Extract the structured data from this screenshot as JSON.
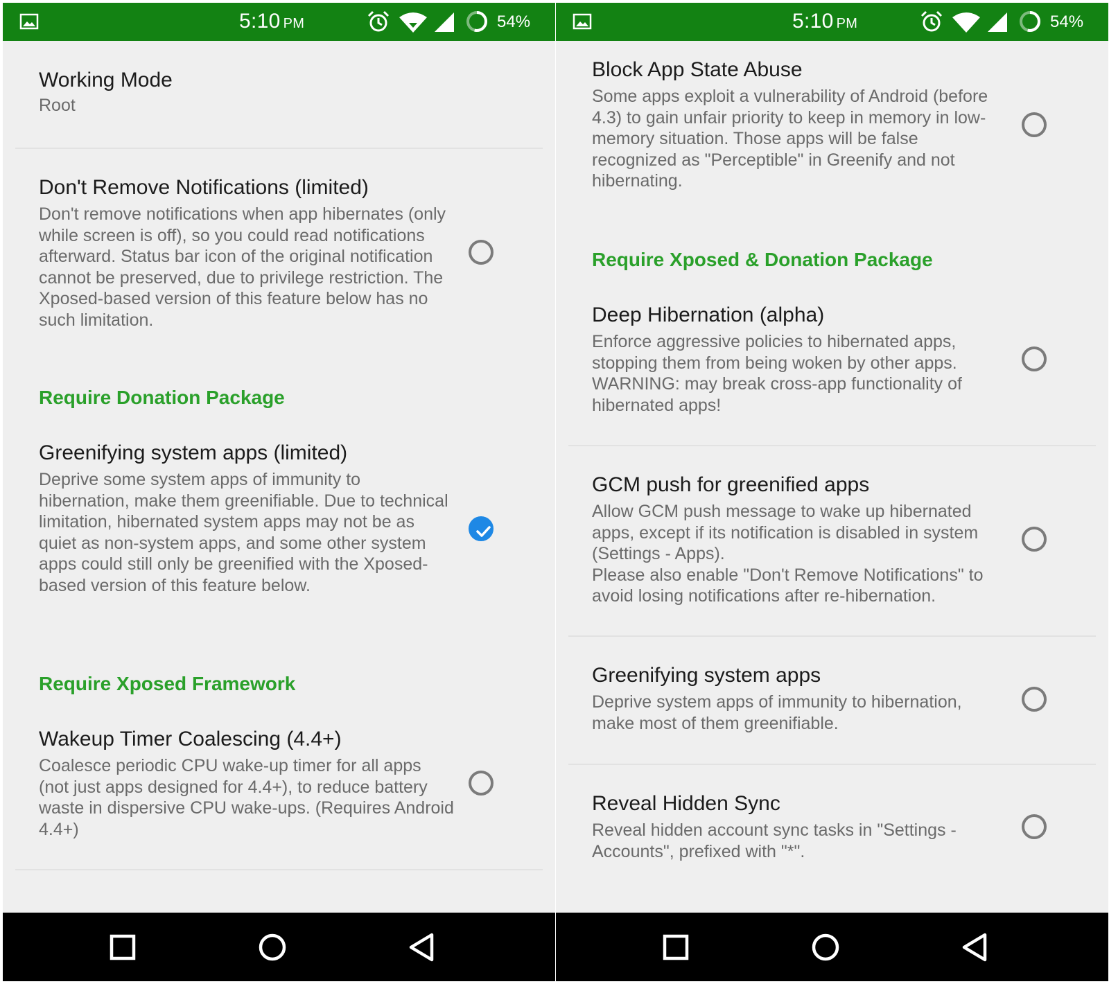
{
  "status_bar": {
    "time": "5:10",
    "ampm": "PM",
    "battery": "54%",
    "icons": [
      "image-icon",
      "alarm-icon",
      "wifi-icon",
      "signal-icon",
      "battery-icon"
    ]
  },
  "colors": {
    "status_bar": "#138213",
    "category": "#2aa02a",
    "checked": "#1e88e5",
    "background": "#efefef"
  },
  "left": {
    "working_mode": {
      "title": "Working Mode",
      "value": "Root"
    },
    "dont_remove": {
      "title": "Don't Remove Notifications (limited)",
      "summary": "Don't remove notifications when app hibernates (only while screen is off), so you could read notifications afterward. Status bar icon of the original notification cannot be preserved, due to privilege restriction. The Xposed-based version of this feature below has no such limitation.",
      "checked": false
    },
    "category_donation": "Require Donation Package",
    "greenify_system_limited": {
      "title": "Greenifying system apps (limited)",
      "summary": "Deprive some system apps of immunity to hibernation, make them greenifiable. Due to technical limitation, hibernated system apps may not be as quiet as non-system apps, and some other system apps could still only be greenified with the Xposed-based version of this feature below.",
      "checked": true
    },
    "category_xposed": "Require Xposed Framework",
    "wakeup_timer": {
      "title": "Wakeup Timer Coalescing (4.4+)",
      "summary": "Coalesce periodic CPU wake-up timer for all apps (not just apps designed for 4.4+), to reduce battery waste in dispersive CPU wake-ups. (Requires Android 4.4+)",
      "checked": false
    }
  },
  "right": {
    "block_app_state": {
      "title": "Block App State Abuse",
      "summary": "Some apps exploit a vulnerability of Android (before 4.3) to gain unfair priority to keep in memory in low-memory situation. Those apps will be false recognized as \"Perceptible\" in Greenify and not hibernating.",
      "checked": false
    },
    "category_xposed_donation": "Require Xposed & Donation Package",
    "deep_hibernation": {
      "title": "Deep Hibernation (alpha)",
      "summary": "Enforce aggressive policies to hibernated apps, stopping them from being woken by other apps. WARNING: may break cross-app functionality of hibernated apps!",
      "checked": false
    },
    "gcm_push": {
      "title": "GCM push for greenified apps",
      "summary_1": "Allow GCM push message to wake up hibernated apps, except if its notification is disabled in system (Settings - Apps).",
      "summary_2": "Please also enable \"Don't Remove Notifications\" to avoid losing notifications after re-hibernation.",
      "checked": false
    },
    "greenify_system": {
      "title": "Greenifying system apps",
      "summary": "Deprive system apps of immunity to hibernation, make most of them greenifiable.",
      "checked": false
    },
    "reveal_sync": {
      "title": "Reveal Hidden Sync",
      "summary": "Reveal hidden account sync tasks in \"Settings - Accounts\", prefixed with \"*\".",
      "checked": false
    }
  },
  "nav": {
    "icons": [
      "recents-icon",
      "home-icon",
      "back-icon"
    ]
  }
}
